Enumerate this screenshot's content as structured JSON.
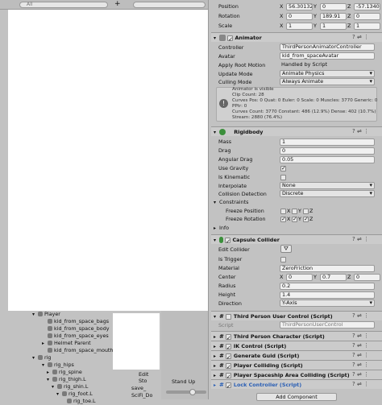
{
  "top": {
    "search_placeholder": "All"
  },
  "transform": {
    "position_label": "Position",
    "rotation_label": "Rotation",
    "scale_label": "Scale",
    "position": {
      "x": "56.30132",
      "y": "0",
      "z": "-57.1340"
    },
    "rotation": {
      "x": "0",
      "y": "189.91",
      "z": "0"
    },
    "scale": {
      "x": "1",
      "y": "1",
      "z": "1"
    }
  },
  "animator": {
    "title": "Animator",
    "controller_label": "Controller",
    "controller_value": "ThirdPersonAnimatorController",
    "avatar_label": "Avatar",
    "avatar_value": "kid_from_spaceAvatar",
    "root_motion_label": "Apply Root Motion",
    "root_motion_value": "Handled by Script",
    "update_mode_label": "Update Mode",
    "update_mode_value": "Animate Physics",
    "culling_label": "Culling Mode",
    "culling_value": "Always Animate",
    "info": [
      "Animator is visible",
      "Clip Count: 28",
      "Curves Pos: 0 Quat: 0 Euler: 0 Scale: 0 Muscles: 3770 Generic: 0",
      "PPtr: 0",
      "Curves Count: 3770 Constant: 486 (12.9%) Dense: 402 (10.7%)",
      "Stream: 2880 (76.4%)"
    ]
  },
  "rigidbody": {
    "title": "Rigidbody",
    "mass_label": "Mass",
    "mass": "1",
    "drag_label": "Drag",
    "drag": "0",
    "ang_drag_label": "Angular Drag",
    "ang_drag": "0.05",
    "gravity_label": "Use Gravity",
    "kinematic_label": "Is Kinematic",
    "interp_label": "Interpolate",
    "interp": "None",
    "collision_label": "Collision Detection",
    "collision": "Discrete",
    "constraints_label": "Constraints",
    "freeze_pos_label": "Freeze Position",
    "freeze_rot_label": "Freeze Rotation",
    "x": "X",
    "y": "Y",
    "z": "Z",
    "info_label": "Info"
  },
  "capsule": {
    "title": "Capsule Collider",
    "edit_label": "Edit Collider",
    "trigger_label": "Is Trigger",
    "material_label": "Material",
    "material": "ZeroFriction",
    "center_label": "Center",
    "center": {
      "x": "0",
      "y": "0.7",
      "z": "0"
    },
    "radius_label": "Radius",
    "radius": "0.2",
    "height_label": "Height",
    "height": "1.4",
    "direction_label": "Direction",
    "direction": "Y-Axis"
  },
  "scripts": [
    {
      "title": "Third Person User Control (Script)",
      "field_label": "Script",
      "field_value": "ThirdPersonUserControl"
    },
    {
      "title": "Third Person Character (Script)"
    },
    {
      "title": "IK Control (Script)"
    },
    {
      "title": "Generate Guid (Script)"
    },
    {
      "title": "Player Colliding (Script)"
    },
    {
      "title": "Player Spaceship Area Colliding (Script)"
    },
    {
      "title": "Lock Controller (Script)"
    }
  ],
  "add_component": "Add Component",
  "hierarchy": [
    "Player",
    "kid_from_space_bags",
    "kid_from_space_body",
    "kid_from_space_eyes",
    "Helmet Parent",
    "kid_from_space_mouth",
    "rig",
    "rig_hips",
    "rig_spine",
    "rig_thigh.L",
    "rig_shin.L",
    "rig_foot.L",
    "rig_toe.L"
  ],
  "project": {
    "items": [
      "Edit",
      "Sto",
      "save_",
      "SciFi_Do"
    ]
  },
  "preview": {
    "label": "Stand Up"
  },
  "colors": {
    "panel": "#c2c2c2",
    "header": "#cbcbcb",
    "accent": "#3c79d0"
  }
}
